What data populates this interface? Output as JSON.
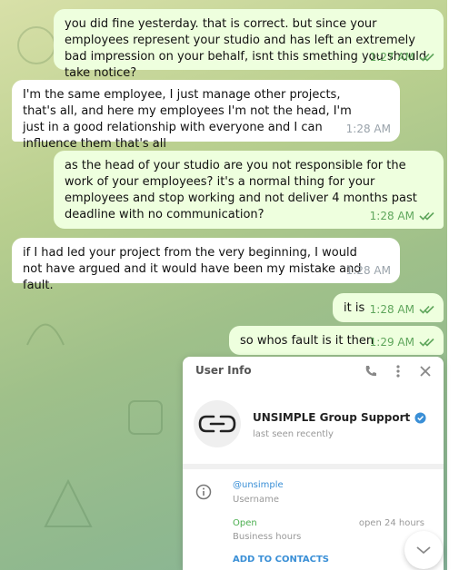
{
  "messages": [
    {
      "direction": "out",
      "text": "you did fine yesterday. that is correct. but since your employees represent your studio and has left an extremely bad impression on your behalf, isnt this smething you should take notice?",
      "time": "1:27 AM",
      "read": true
    },
    {
      "direction": "in",
      "text": "I'm the same employee, I just manage other projects, that's all, and here my employees I'm not the head, I'm just in a good relationship with everyone and I can influence them that's all",
      "time": "1:28 AM"
    },
    {
      "direction": "out",
      "text": "as the head of your studio are you not responsible for the work of your employees? it's a normal thing for your employees and stop working and not deliver 4 months past deadline with no communication?",
      "time": "1:28 AM",
      "read": true
    },
    {
      "direction": "in",
      "text": "if I had led your project from the very beginning, I would not have argued and it would have been my mistake and fault.",
      "time": "1:28 AM"
    },
    {
      "direction": "out",
      "text": "it is",
      "time": "1:28 AM",
      "read": true
    },
    {
      "direction": "out",
      "text": "so whos fault is it then",
      "time": "1:29 AM",
      "read": true
    }
  ],
  "user_info": {
    "title": "User Info",
    "name": "UNSIMPLE Group Support",
    "last_seen": "last seen recently",
    "username": "@unsimple",
    "username_label": "Username",
    "status": "Open",
    "hours_label": "Business hours",
    "hours": "open 24 hours",
    "add_contacts": "ADD TO CONTACTS"
  },
  "colors": {
    "outgoing_bubble": "#eeffde",
    "incoming_bubble": "#ffffff",
    "accent": "#3a8fd6",
    "check": "#5fa65c"
  }
}
